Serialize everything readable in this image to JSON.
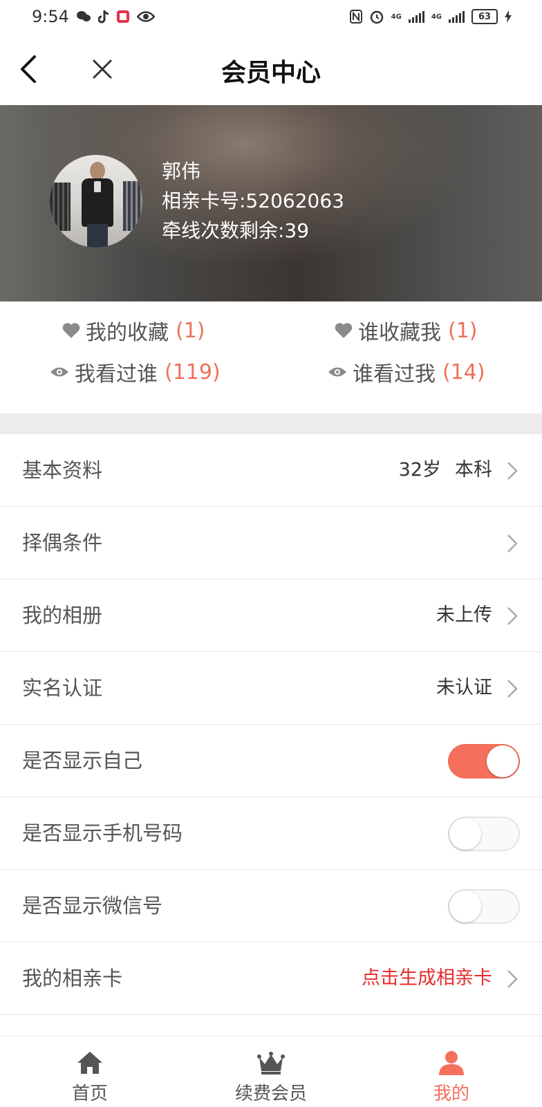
{
  "status_bar": {
    "time": "9:54",
    "battery": "63",
    "network1": "4G",
    "network2": "4G"
  },
  "header": {
    "title": "会员中心"
  },
  "profile": {
    "name": "郭伟",
    "card_line": "相亲卡号:52062063",
    "remaining_line": "牵线次数剩余:39"
  },
  "stats": {
    "my_favorites": {
      "label": "我的收藏",
      "count": "(1)"
    },
    "who_favorited_me": {
      "label": "谁收藏我",
      "count": "(1)"
    },
    "i_viewed": {
      "label": "我看过谁",
      "count": "(119)"
    },
    "who_viewed_me": {
      "label": "谁看过我",
      "count": "(14)"
    }
  },
  "menu": {
    "basic_info": {
      "label": "基本资料",
      "age": "32岁",
      "education": "本科"
    },
    "partner_criteria": {
      "label": "择偶条件"
    },
    "album": {
      "label": "我的相册",
      "value": "未上传"
    },
    "real_name": {
      "label": "实名认证",
      "value": "未认证"
    },
    "show_self": {
      "label": "是否显示自己",
      "on": true
    },
    "show_phone": {
      "label": "是否显示手机号码",
      "on": false
    },
    "show_wechat": {
      "label": "是否显示微信号",
      "on": false
    },
    "dating_card": {
      "label": "我的相亲卡",
      "value": "点击生成相亲卡"
    }
  },
  "bottom_nav": [
    {
      "label": "首页",
      "icon": "home-icon",
      "active": false
    },
    {
      "label": "续费会员",
      "icon": "crown-icon",
      "active": false
    },
    {
      "label": "我的",
      "icon": "person-icon",
      "active": true
    }
  ],
  "colors": {
    "accent": "#f4705c",
    "link_red": "#e62d2d",
    "count": "#f0705a"
  }
}
